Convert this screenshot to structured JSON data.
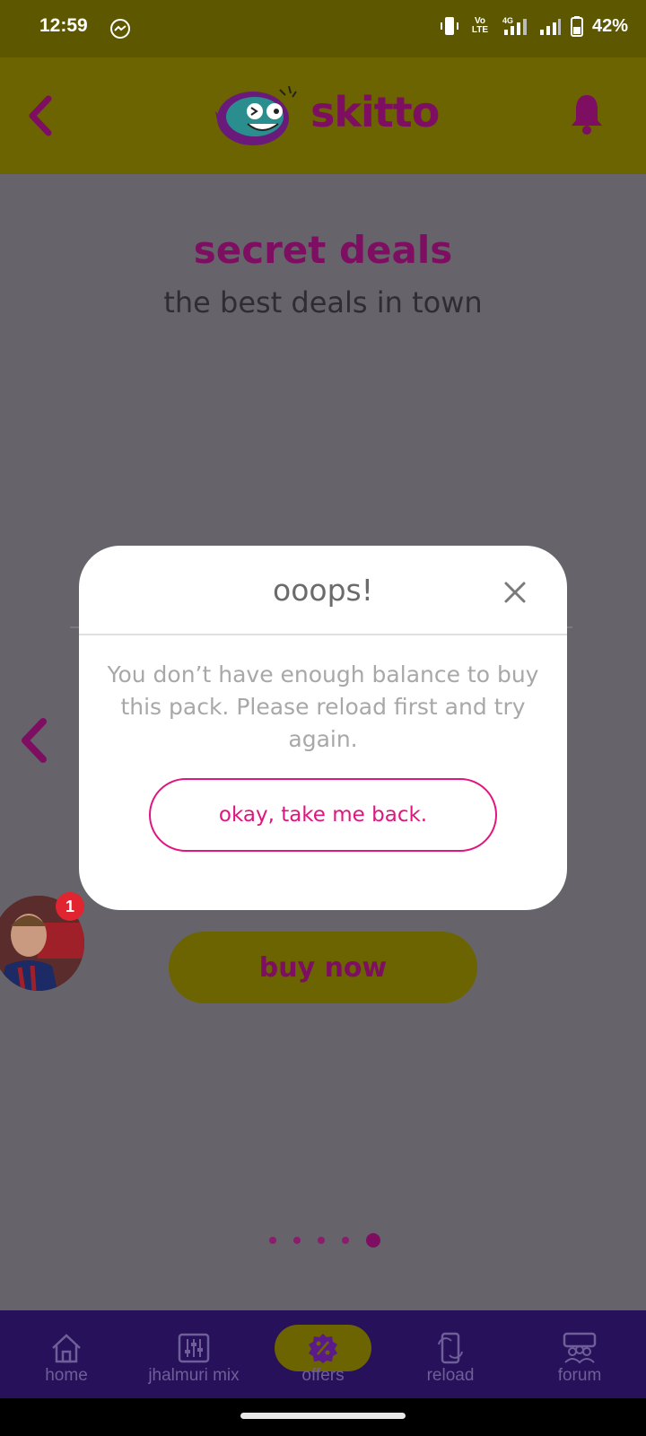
{
  "status_bar": {
    "time": "12:59",
    "battery": "42%",
    "messenger_icon": "messenger-icon",
    "vibrate_icon": "vibrate-icon",
    "volte_label": "Vo LTE",
    "network_label": "4G"
  },
  "app_bar": {
    "brand": "skitto",
    "back_icon": "chevron-left-icon",
    "bell_icon": "bell-icon"
  },
  "page": {
    "title": "secret deals",
    "subtitle": "the best deals in town",
    "buy_now_label": "buy now",
    "carousel": {
      "count": 5,
      "active_index": 4
    }
  },
  "chat_head": {
    "badge_count": "1"
  },
  "dialog": {
    "title": "ooops!",
    "message": "You don’t have enough  balance  to buy this pack. Please reload first and try again.",
    "button_label": "okay, take me back.",
    "close_icon": "close-icon"
  },
  "bottom_nav": {
    "items": [
      {
        "label": "home",
        "icon": "home-icon"
      },
      {
        "label": "jhalmuri mix",
        "icon": "sliders-icon"
      },
      {
        "label": "offers",
        "icon": "percent-badge-icon",
        "active": true
      },
      {
        "label": "reload",
        "icon": "phone-reload-icon"
      },
      {
        "label": "forum",
        "icon": "forum-icon"
      }
    ]
  },
  "colors": {
    "brand_magenta": "#7e0e62",
    "accent_pink": "#e0157f",
    "olive": "#6b6400",
    "nav_bg": "#27115a"
  }
}
